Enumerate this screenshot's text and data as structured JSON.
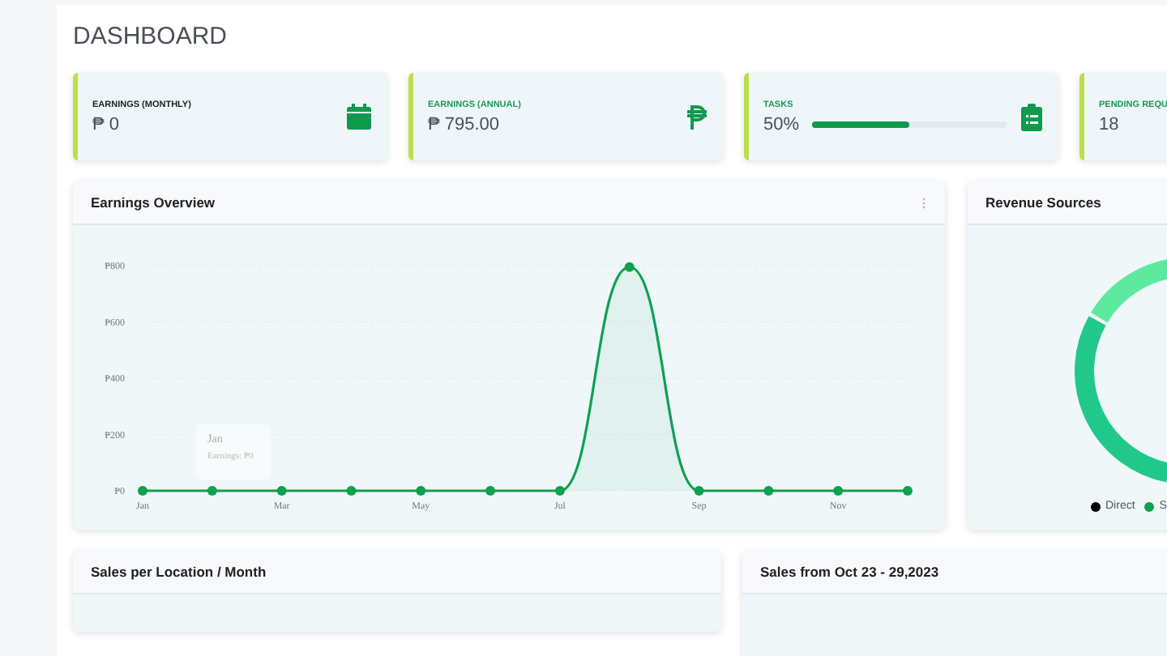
{
  "page_title": "DASHBOARD",
  "stat_cards": [
    {
      "kind": "value",
      "label": "EARNINGS (MONTHLY)",
      "value": "₱ 0",
      "accent": false
    },
    {
      "kind": "value",
      "label": "EARNINGS (ANNUAL)",
      "value": "₱ 795.00",
      "accent": true
    },
    {
      "kind": "progress",
      "label": "TASKS",
      "value": "50%",
      "level": 0.5,
      "accent": true
    },
    {
      "kind": "value",
      "label": "PENDING REQU",
      "value": "18",
      "accent": true
    }
  ],
  "earnings_overview": {
    "title": "Earnings Overview",
    "tooltip": {
      "title": "Jan",
      "text": "Earnings: ₱0"
    },
    "chart_data": {
      "type": "area",
      "categories": [
        "Jan",
        null,
        "Mar",
        null,
        "May",
        null,
        "Jul",
        null,
        "Sep",
        null,
        "Nov",
        null
      ],
      "grid": true,
      "series": [
        {
          "color": "#10a050",
          "values": [
            0,
            0,
            0,
            0,
            0,
            0,
            0,
            795,
            0,
            0,
            0,
            0
          ]
        }
      ],
      "ylim": [
        0,
        800
      ],
      "yticks": [
        {
          "value": 0,
          "label": "₱0"
        },
        {
          "value": 200,
          "label": "₱200"
        },
        {
          "value": 400,
          "label": "₱400"
        },
        {
          "value": 600,
          "label": "₱600"
        },
        {
          "value": 800,
          "label": "₱800"
        }
      ]
    }
  },
  "revenue_sources": {
    "title": "Revenue Sources",
    "legend": [
      {
        "label": "Direct",
        "color": "#000000"
      },
      {
        "label": "S",
        "color": "#10a050"
      }
    ]
  },
  "bottom_cards": [
    {
      "title": "Sales per Location / Month"
    },
    {
      "title": "Sales from Oct 23 - 29,2023"
    }
  ]
}
